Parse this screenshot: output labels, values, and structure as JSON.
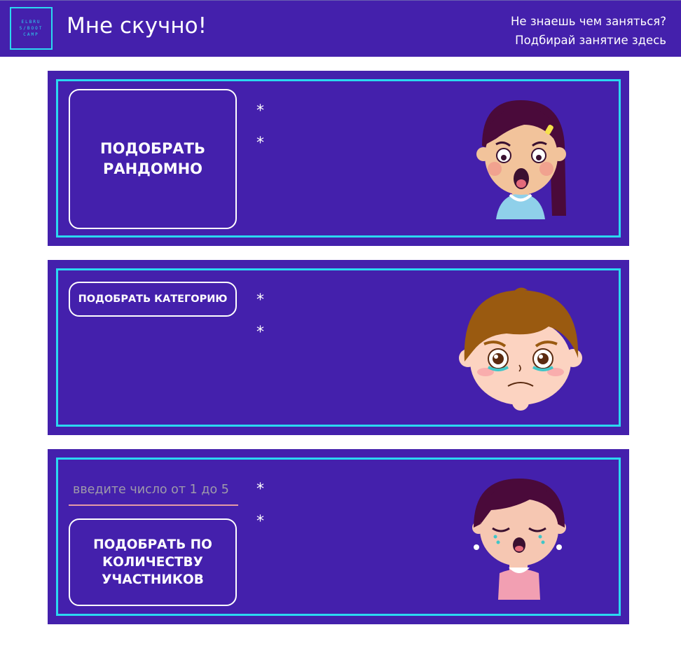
{
  "header": {
    "logo_text": "ELBRUS/BOOTCAMP",
    "title": "Мне скучно!",
    "tagline_line1": "Не знаешь чем заняться?",
    "tagline_line2": "Подбирай занятие здесь"
  },
  "cards": [
    {
      "button_label": "ПОДОБРАТЬ РАНДОМНО",
      "bullets": [
        "*",
        "*"
      ],
      "face_icon": "sad-girl-icon"
    },
    {
      "button_label": "ПОДОБРАТЬ КАТЕГОРИЮ",
      "bullets": [
        "*",
        "*"
      ],
      "face_icon": "crying-boy-icon"
    },
    {
      "input_placeholder": "введите число от 1 до 5",
      "button_label": "ПОДОБРАТЬ ПО КОЛИЧЕСТВУ УЧАСТНИКОВ",
      "bullets": [
        "*",
        "*"
      ],
      "face_icon": "crying-girl-icon"
    }
  ],
  "colors": {
    "primary": "#4420ac",
    "accent": "#2bd8f0",
    "text": "#ffffff"
  }
}
